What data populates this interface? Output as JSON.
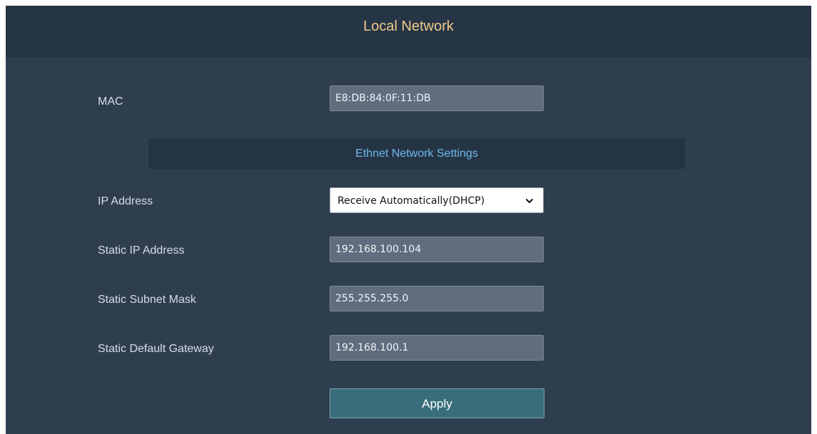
{
  "header": {
    "title": "Local Network"
  },
  "mac": {
    "label": "MAC",
    "value": "E8:DB:84:0F:11:DB"
  },
  "ethernet_section": {
    "title": "Ethnet Network Settings"
  },
  "ip_address": {
    "label": "IP Address",
    "selected": "Receive Automatically(DHCP)"
  },
  "static_ip": {
    "label": "Static IP Address",
    "value": "192.168.100.104"
  },
  "static_subnet": {
    "label": "Static Subnet Mask",
    "value": "255.255.255.0"
  },
  "static_gateway": {
    "label": "Static Default Gateway",
    "value": "192.168.100.1"
  },
  "actions": {
    "apply_label": "Apply"
  },
  "colors": {
    "background": "#2f3e4f",
    "header": "#263545",
    "title": "#f0c98a",
    "section_title": "#6fb9ec",
    "field": "#5f6d7e",
    "apply_button": "#376e79"
  },
  "icons": {
    "select_arrow": "chevron-down-icon"
  }
}
